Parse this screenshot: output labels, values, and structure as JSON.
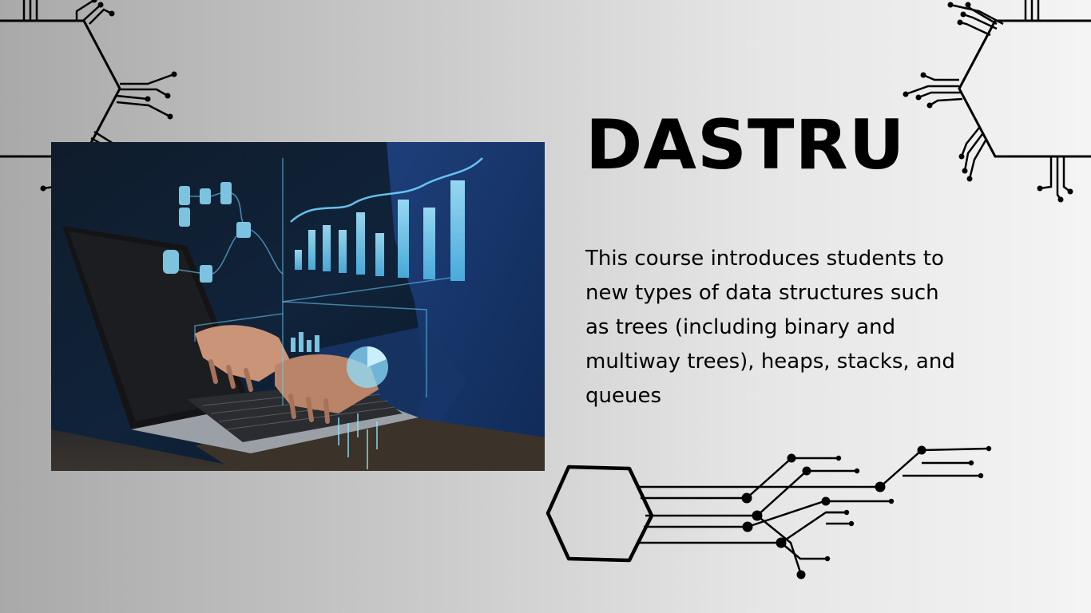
{
  "slide": {
    "title": "DASTRU",
    "description": "This course introduces students to new types of data structures such as trees (including binary and multiway trees), heaps, stacks, and queues"
  },
  "colors": {
    "background_left": "#a9a9a9",
    "background_right": "#f4f4f4",
    "text": "#000000",
    "photo_accent": "#6fd2ff"
  },
  "decorations": {
    "top_left": "hexagon-circuit-icon",
    "top_right": "hexagon-circuit-icon",
    "bottom": "hexagon-circuit-icon"
  },
  "photo": {
    "subject": "hands typing on laptop with data-analytics hologram"
  }
}
